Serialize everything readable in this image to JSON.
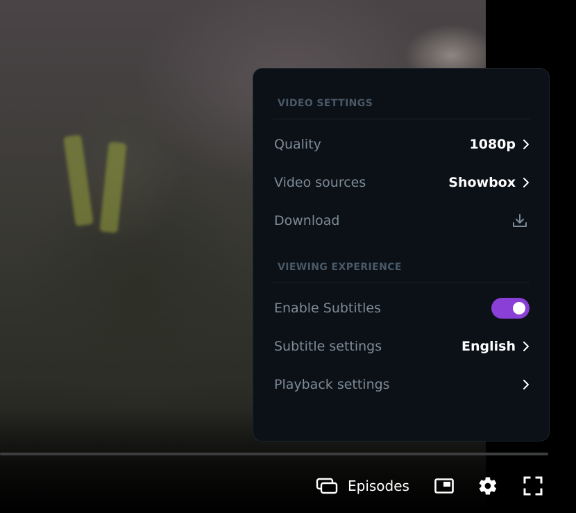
{
  "settings": {
    "video_section_title": "VIDEO SETTINGS",
    "quality": {
      "label": "Quality",
      "value": "1080p"
    },
    "video_sources": {
      "label": "Video sources",
      "value": "Showbox"
    },
    "download": {
      "label": "Download"
    },
    "viewing_section_title": "VIEWING EXPERIENCE",
    "enable_subtitles": {
      "label": "Enable Subtitles",
      "enabled": true
    },
    "subtitle_settings": {
      "label": "Subtitle settings",
      "value": "English"
    },
    "playback_settings": {
      "label": "Playback settings"
    }
  },
  "controls": {
    "episodes_label": "Episodes"
  },
  "icons": {
    "episodes": "episodes-icon",
    "pip": "picture-in-picture-icon",
    "settings": "gear-icon",
    "fullscreen": "fullscreen-icon",
    "chevron": "chevron-right-icon",
    "download": "download-icon"
  },
  "colors": {
    "accent": "#8a3fd6",
    "panel_bg": "#0b1117",
    "label": "#7f8b97",
    "section_title": "#4b5866",
    "value": "#ffffff"
  }
}
